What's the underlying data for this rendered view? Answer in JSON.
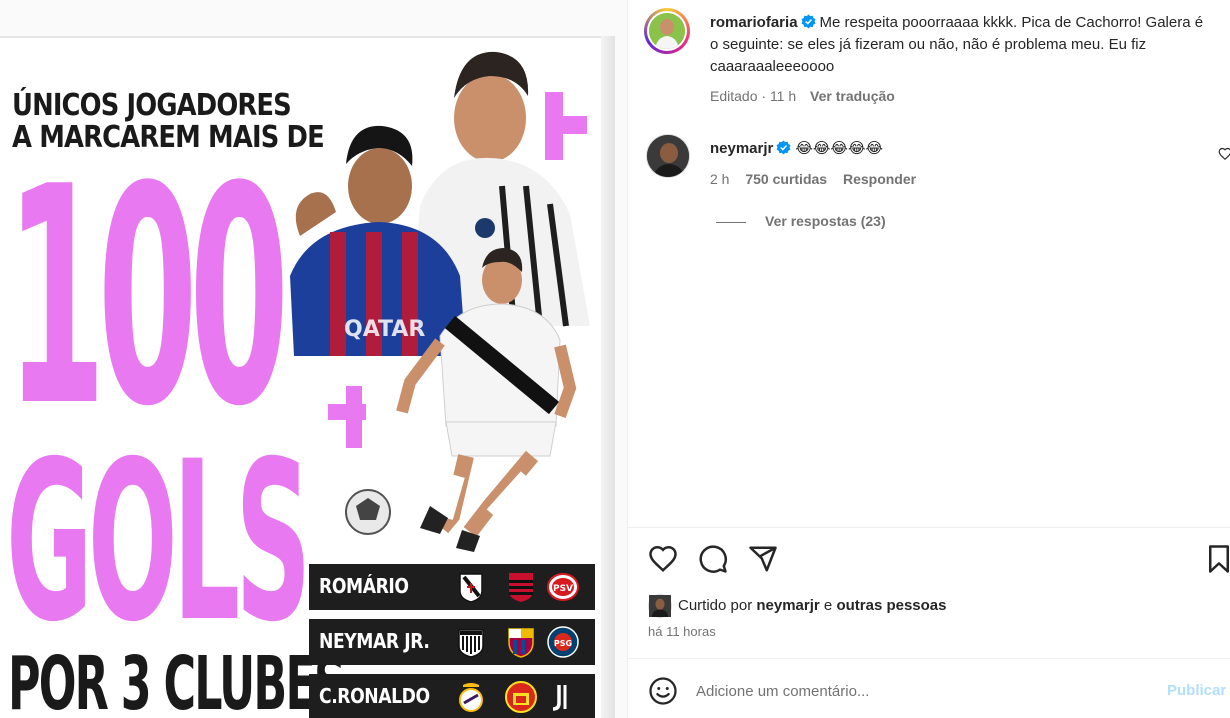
{
  "post": {
    "headline_line1": "ÚNICOS JOGADORES",
    "headline_line2": "A MARCAREM MAIS DE",
    "big_number": "100",
    "big_word": "GOLS",
    "bottom_line": "POR 3 CLUBES",
    "accent_color": "#e879f0",
    "clubs": [
      {
        "player": "ROMÁRIO",
        "crests": [
          "vasco-crest-icon",
          "flamengo-crest-icon",
          "psv-crest-icon"
        ]
      },
      {
        "player": "NEYMAR JR.",
        "crests": [
          "santos-crest-icon",
          "barcelona-crest-icon",
          "psg-crest-icon"
        ]
      },
      {
        "player": "C.RONALDO",
        "crests": [
          "real-madrid-crest-icon",
          "manchester-united-crest-icon",
          "juventus-crest-icon"
        ]
      }
    ],
    "crest_labels": {
      "psv": "PSV",
      "psg": "PSG"
    }
  },
  "caption": {
    "username": "romariofaria",
    "text": "Me respeita pooorraaaa kkkk. Pica de Cachorro! Galera é o seguinte: se eles já fizeram ou não, não é problema meu. Eu fiz caaaraaaleeeoooo",
    "edited": "Editado",
    "dot": "·",
    "time": "11 h",
    "translate": "Ver tradução"
  },
  "comment": {
    "username": "neymarjr",
    "emojis": "😂😂😂😂😂",
    "time": "2 h",
    "likes": "750 curtidas",
    "reply": "Responder",
    "view_replies": "Ver respostas (23)"
  },
  "likes": {
    "prefix": "Curtido por",
    "user": "neymarjr",
    "joiner": "e",
    "others": "outras pessoas",
    "time_ago": "há 11 horas"
  },
  "composer": {
    "placeholder": "Adicione um comentário...",
    "publish": "Publicar"
  },
  "icons": {
    "like": "heart-icon",
    "comment": "comment-icon",
    "share": "share-icon",
    "save": "bookmark-icon",
    "emoji": "emoji-icon",
    "verified": "verified-icon"
  }
}
